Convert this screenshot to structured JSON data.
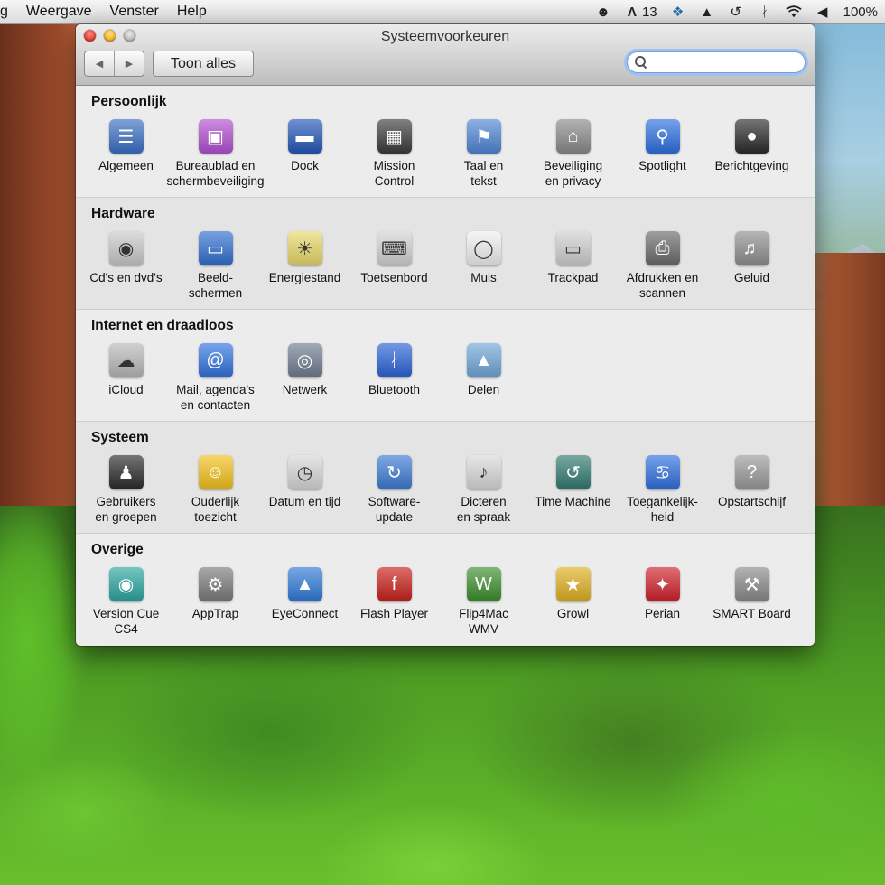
{
  "menubar": {
    "items": [
      "g",
      "Weergave",
      "Venster",
      "Help"
    ],
    "status": {
      "adobe_count": "13",
      "battery": "100%"
    },
    "status_icons": [
      "evernote-icon",
      "adobe-icon",
      "dropbox-icon",
      "hat-icon",
      "time-machine-icon",
      "bluetooth-icon",
      "wifi-icon",
      "volume-icon"
    ]
  },
  "window": {
    "title": "Systeemvoorkeuren",
    "show_all_label": "Toon alles",
    "search": {
      "value": "",
      "placeholder": ""
    }
  },
  "sections": [
    {
      "title": "Persoonlijk",
      "items": [
        {
          "label": "Algemeen",
          "icon": "general-icon",
          "color": "#3a6fc4"
        },
        {
          "label": "Bureaublad en\nschermbeveiliging",
          "icon": "desktop-icon",
          "color": "#b24fd0"
        },
        {
          "label": "Dock",
          "icon": "dock-icon",
          "color": "#2456b8"
        },
        {
          "label": "Mission\nControl",
          "icon": "mission-control-icon",
          "color": "#3c3c3c"
        },
        {
          "label": "Taal en\ntekst",
          "icon": "language-icon",
          "color": "#4f86d6"
        },
        {
          "label": "Beveiliging\nen privacy",
          "icon": "security-icon",
          "color": "#8a8a8a"
        },
        {
          "label": "Spotlight",
          "icon": "spotlight-icon",
          "color": "#2d6fe0"
        },
        {
          "label": "Berichtgeving",
          "icon": "notifications-icon",
          "color": "#2b2b2b"
        }
      ]
    },
    {
      "title": "Hardware",
      "items": [
        {
          "label": "Cd's en dvd's",
          "icon": "cd-icon",
          "color": "#c9c9c9"
        },
        {
          "label": "Beeld-\nschermen",
          "icon": "display-icon",
          "color": "#2f6fcf"
        },
        {
          "label": "Energiestand",
          "icon": "energy-icon",
          "color": "#e8d86a"
        },
        {
          "label": "Toetsenbord",
          "icon": "keyboard-icon",
          "color": "#d2d2d2"
        },
        {
          "label": "Muis",
          "icon": "mouse-icon",
          "color": "#f0f0f0"
        },
        {
          "label": "Trackpad",
          "icon": "trackpad-icon",
          "color": "#cfcfcf"
        },
        {
          "label": "Afdrukken en\nscannen",
          "icon": "printer-icon",
          "color": "#6a6a6a"
        },
        {
          "label": "Geluid",
          "icon": "speaker-icon",
          "color": "#8e8e8e"
        }
      ]
    },
    {
      "title": "Internet en draadloos",
      "items": [
        {
          "label": "iCloud",
          "icon": "icloud-icon",
          "color": "#b8b8b8"
        },
        {
          "label": "Mail, agenda's\nen contacten",
          "icon": "mail-icon",
          "color": "#2f72e0"
        },
        {
          "label": "Netwerk",
          "icon": "network-icon",
          "color": "#6f7c8f"
        },
        {
          "label": "Bluetooth",
          "icon": "bluetooth-icon",
          "color": "#2a62d6"
        },
        {
          "label": "Delen",
          "icon": "sharing-icon",
          "color": "#6fa6d8"
        }
      ]
    },
    {
      "title": "Systeem",
      "items": [
        {
          "label": "Gebruikers\nen groepen",
          "icon": "users-icon",
          "color": "#2a2a2a"
        },
        {
          "label": "Ouderlijk\ntoezicht",
          "icon": "parental-controls-icon",
          "color": "#f2c21a"
        },
        {
          "label": "Datum en tijd",
          "icon": "clock-icon",
          "color": "#d8d8d8"
        },
        {
          "label": "Software-\nupdate",
          "icon": "software-update-icon",
          "color": "#3b7ad4"
        },
        {
          "label": "Dicteren\nen spraak",
          "icon": "microphone-icon",
          "color": "#d9d9d9"
        },
        {
          "label": "Time Machine",
          "icon": "time-machine-icon",
          "color": "#2f7a6f"
        },
        {
          "label": "Toegankelijk-\nheid",
          "icon": "accessibility-icon",
          "color": "#2f6fe0"
        },
        {
          "label": "Opstartschijf",
          "icon": "startup-disk-icon",
          "color": "#9a9a9a"
        }
      ]
    },
    {
      "title": "Overige",
      "items": [
        {
          "label": "Version Cue\nCS4",
          "icon": "version-cue-icon",
          "color": "#2aa6a0"
        },
        {
          "label": "AppTrap",
          "icon": "apptrap-icon",
          "color": "#7a7a7a"
        },
        {
          "label": "EyeConnect",
          "icon": "eyeconnect-icon",
          "color": "#2f7ad8"
        },
        {
          "label": "Flash Player",
          "icon": "flash-icon",
          "color": "#c8201a"
        },
        {
          "label": "Flip4Mac\nWMV",
          "icon": "flip4mac-icon",
          "color": "#3a8f2a"
        },
        {
          "label": "Growl",
          "icon": "growl-icon",
          "color": "#e0b020"
        },
        {
          "label": "Perian",
          "icon": "perian-icon",
          "color": "#d0202a"
        },
        {
          "label": "SMART Board",
          "icon": "smart-board-icon",
          "color": "#8a8a8a"
        }
      ]
    }
  ]
}
